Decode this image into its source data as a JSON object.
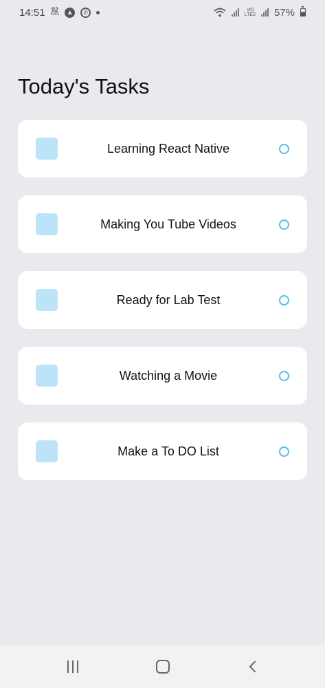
{
  "status_bar": {
    "time": "14:51",
    "net_speed": "92",
    "net_unit": "KB/s",
    "lte_top": "Vo)",
    "lte_bottom": "LTE2",
    "battery": "57%"
  },
  "title": "Today's Tasks",
  "tasks": [
    {
      "label": "Learning React Native"
    },
    {
      "label": "Making You Tube Videos"
    },
    {
      "label": "Ready for Lab Test"
    },
    {
      "label": "Watching a Movie"
    },
    {
      "label": "Make a To DO List"
    }
  ],
  "colors": {
    "background": "#e8eaed",
    "card": "#ffffff",
    "square": "#bde3f8",
    "circle": "#55bcec"
  },
  "icons": {
    "square": "task-square-icon",
    "circle": "task-circle-icon",
    "nav_recents": "recents-icon",
    "nav_home": "home-icon",
    "nav_back": "back-icon"
  }
}
